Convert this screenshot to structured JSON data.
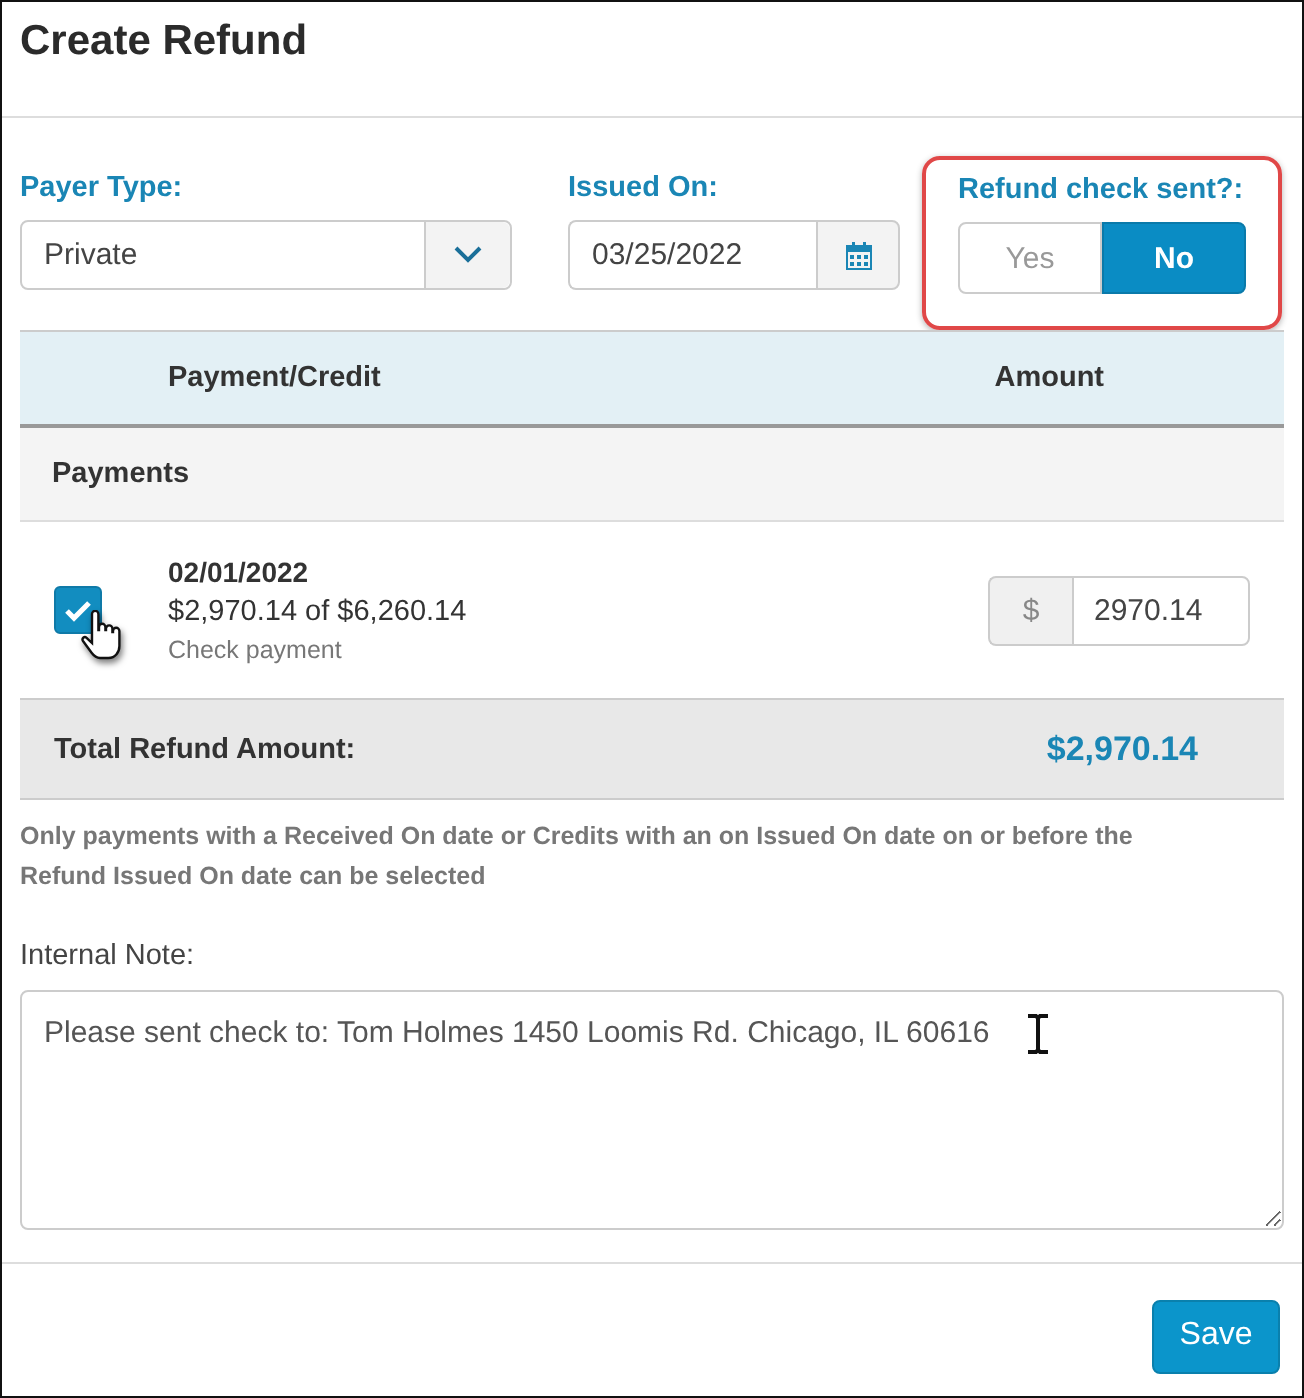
{
  "dialog": {
    "title": "Create Refund"
  },
  "payer_type": {
    "label": "Payer Type:",
    "value": "Private"
  },
  "issued_on": {
    "label": "Issued On:",
    "value": "03/25/2022"
  },
  "refund_check_sent": {
    "label": "Refund check sent?:",
    "highlighted": true,
    "options": [
      {
        "label": "Yes",
        "selected": false
      },
      {
        "label": "No",
        "selected": true
      }
    ]
  },
  "table": {
    "columns": [
      "Payment/Credit",
      "Amount"
    ],
    "groups": [
      {
        "title": "Payments",
        "rows": [
          {
            "date": "02/01/2022",
            "summary": "$2,970.14 of $6,260.14",
            "method": "Check payment",
            "checked": true,
            "currency": "$",
            "amount": "2970.14"
          }
        ]
      }
    ],
    "total": {
      "label": "Total Refund Amount:",
      "value": "$2,970.14"
    }
  },
  "notice": "Only payments with a Received On date or Credits with an on Issued On date on or before the Refund Issued On date can be selected",
  "internal_note": {
    "label": "Internal Note:",
    "value": "Please sent check to: Tom Holmes 1450 Loomis Rd. Chicago, IL 60616"
  },
  "buttons": [
    {
      "label": "Save"
    }
  ]
}
